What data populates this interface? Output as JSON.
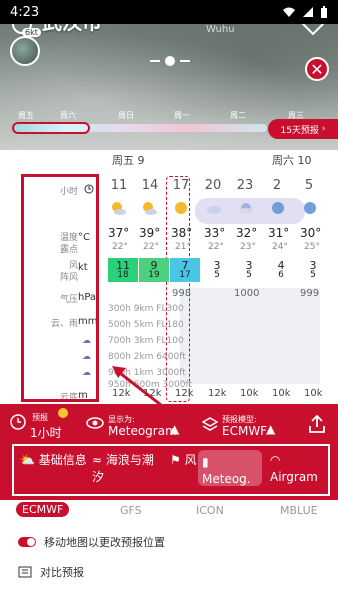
{
  "status": {
    "time": "4:23"
  },
  "location": {
    "city": "武汉市",
    "badge": "6kt"
  },
  "timeline": {
    "days": [
      "周五",
      "周六",
      "周日",
      "周一",
      "周二",
      "周三"
    ],
    "forecast_button": "15天预报"
  },
  "meteogram": {
    "day_headers": [
      "周五 9",
      "周六 10"
    ],
    "labels": {
      "hours": "小时",
      "temp": "温度",
      "dew": "露点",
      "wind": "风",
      "gust": "阵风",
      "pressure": "气压",
      "cloud_rain": "云、雨",
      "cloud_base": "云底"
    },
    "units": {
      "temp": "°C",
      "wind": "kt",
      "pressure": "hPa",
      "rain": "mm",
      "cloud_base": "m"
    },
    "hours": [
      "11",
      "14",
      "17",
      "20",
      "23",
      "2",
      "5"
    ],
    "temps": [
      "37°",
      "39°",
      "38°",
      "33°",
      "32°",
      "31°",
      "30°"
    ],
    "dews": [
      "22°",
      "22°",
      "21°",
      "22°",
      "23°",
      "24°",
      "25°"
    ],
    "winds": [
      "11",
      "9",
      "7",
      "3",
      "3",
      "4",
      "3"
    ],
    "gusts": [
      "18",
      "19",
      "17",
      "5",
      "5",
      "6",
      "5"
    ],
    "pressure": [
      "998",
      "1000",
      "999"
    ],
    "cloud_levels": [
      "300h 9km FL300",
      "500h 5km FL180",
      "700h 3km FL100",
      "800h 2km 6400ft",
      "900h 1km 3000ft",
      "950h 500m 3000ft"
    ],
    "cloud_base": [
      "12k",
      "12k",
      "12k",
      "12k",
      "10k",
      "10k",
      "10k"
    ]
  },
  "panel": {
    "forecast_label": "预报",
    "forecast_value": "1小时",
    "display_label": "显示为:",
    "display_value": "Meteogram",
    "model_label": "预报模型:",
    "model_value": "ECMWF",
    "categories": [
      "基础信息",
      "海浪与潮汐",
      "风",
      "Meteog.",
      "Airgram"
    ]
  },
  "models": [
    "ECMWF",
    "GFS",
    "ICON",
    "MBLUE"
  ],
  "options": {
    "move_map": "移动地图以更改预报位置",
    "compare": "对比预报"
  },
  "colors": {
    "accent": "#c8102e"
  }
}
